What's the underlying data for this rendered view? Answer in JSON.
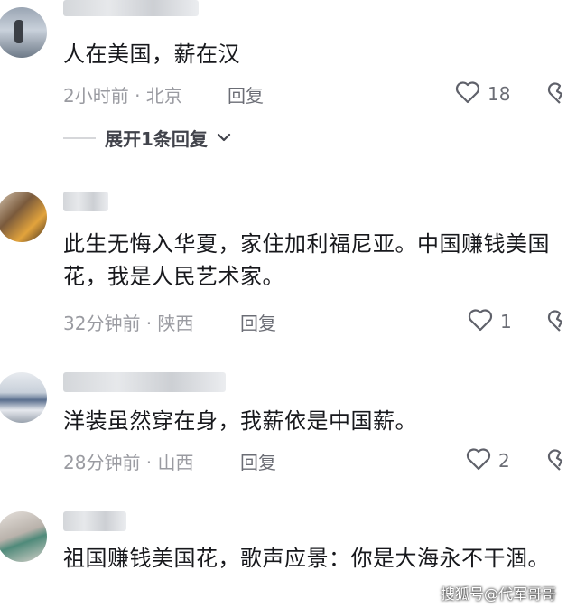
{
  "comments": [
    {
      "text": "人在美国，薪在汉",
      "time_location": "2小时前 · 北京",
      "reply_label": "回复",
      "likes": "18"
    },
    {
      "text": "此生无悔入华夏，家住加利福尼亚。中国赚钱美国花，我是人民艺术家。",
      "time_location": "32分钟前 · 陕西",
      "reply_label": "回复",
      "likes": "1"
    },
    {
      "text": "洋装虽然穿在身，我薪依是中国薪。",
      "time_location": "28分钟前 · 山西",
      "reply_label": "回复",
      "likes": "2"
    },
    {
      "text": "祖国赚钱美国花，歌声应景：你是大海永不干涸。"
    }
  ],
  "expand_replies_label": "展开1条回复",
  "watermark": "搜狐号@代军哥哥",
  "icons": {
    "like": "heart-icon",
    "dislike": "broken-heart-icon",
    "expand": "chevron-down-icon"
  }
}
